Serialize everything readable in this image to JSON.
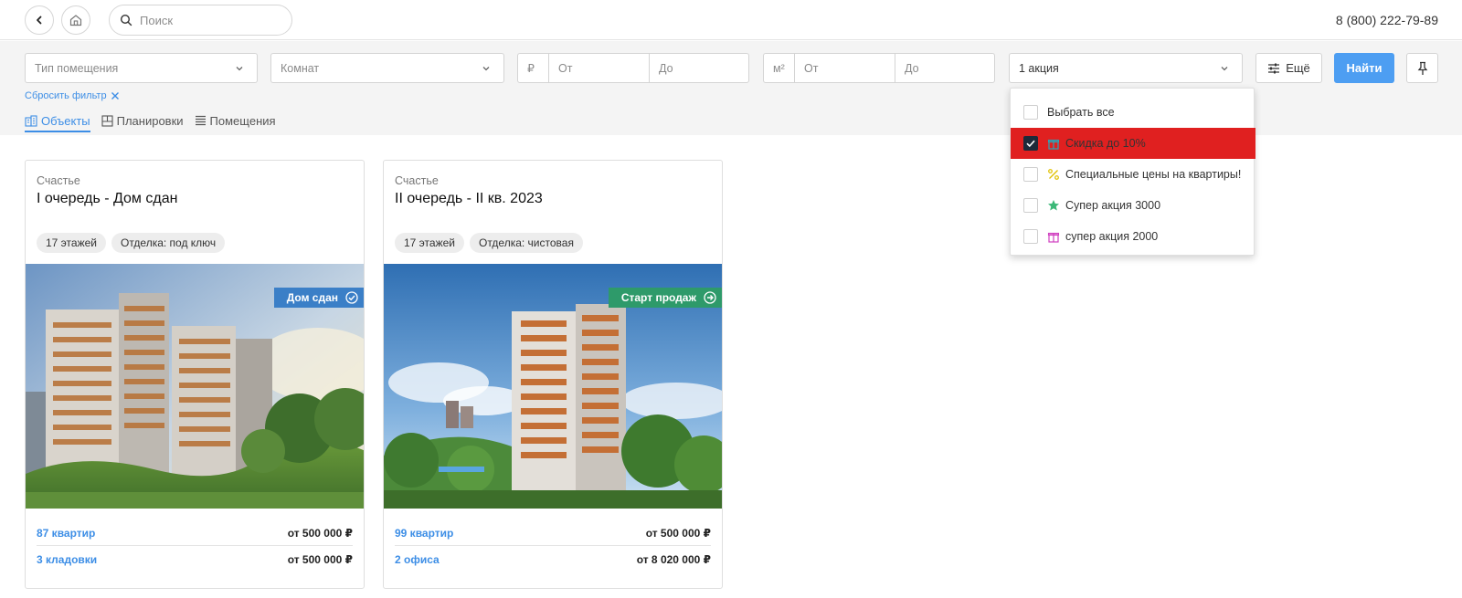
{
  "header": {
    "search_placeholder": "Поиск",
    "phone": "8 (800) 222-79-89"
  },
  "filters": {
    "type_placeholder": "Тип помещения",
    "rooms_placeholder": "Комнат",
    "price_unit": "₽",
    "price_from": "От",
    "price_to": "До",
    "area_unit": "м²",
    "area_from": "От",
    "area_to": "До",
    "promo_value": "1 акция",
    "more_label": "Ещё",
    "find_label": "Найти",
    "reset_label": "Сбросить фильтр"
  },
  "tabs": [
    {
      "label": "Объекты",
      "active": true
    },
    {
      "label": "Планировки",
      "active": false
    },
    {
      "label": "Помещения",
      "active": false
    }
  ],
  "dropdown": {
    "items": [
      {
        "label": "Выбрать все",
        "checked": false,
        "icon": "none"
      },
      {
        "label": "Скидка до 10%",
        "checked": true,
        "icon": "gift-icon",
        "icon_color": "#2aa6b8"
      },
      {
        "label": "Специальные цены на квартиры!",
        "checked": false,
        "icon": "percent-icon",
        "icon_color": "#e0c000"
      },
      {
        "label": "Супер акция 3000",
        "checked": false,
        "icon": "star-icon",
        "icon_color": "#3cb878"
      },
      {
        "label": "супер акция 2000",
        "checked": false,
        "icon": "gift-icon",
        "icon_color": "#d040c0"
      }
    ]
  },
  "cards": [
    {
      "subtitle": "Счастье",
      "title": "I очередь - Дом сдан",
      "chips": [
        "17 этажей",
        "Отделка: под ключ"
      ],
      "badge": "Дом сдан",
      "badge_color": "#3b7fc7",
      "rows": [
        {
          "label": "87 квартир",
          "price": "от 500 000 ₽"
        },
        {
          "label": "3 кладовки",
          "price": "от 500 000 ₽"
        }
      ]
    },
    {
      "subtitle": "Счастье",
      "title": "II очередь - II кв. 2023",
      "chips": [
        "17 этажей",
        "Отделка: чистовая"
      ],
      "badge": "Старт продаж",
      "badge_color": "#2e9a6a",
      "rows": [
        {
          "label": "99 квартир",
          "price": "от 500 000 ₽"
        },
        {
          "label": "2 офиса",
          "price": "от 8 020 000 ₽"
        }
      ]
    }
  ],
  "colors": {
    "accent": "#4d9ef2",
    "link": "#3d8ee6",
    "highlight": "#e02020"
  }
}
